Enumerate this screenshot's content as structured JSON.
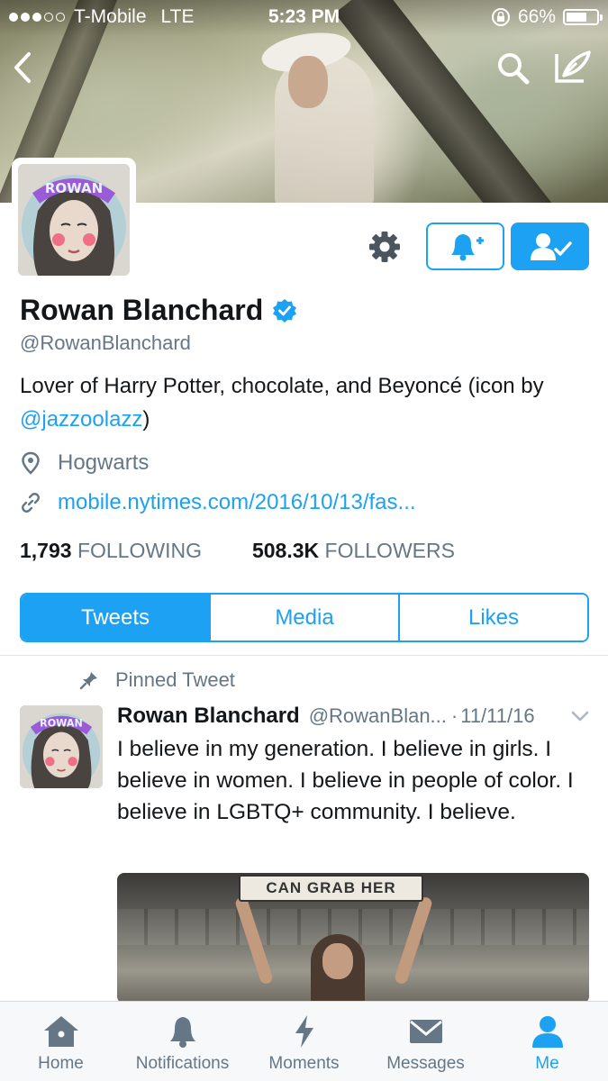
{
  "status_bar": {
    "carrier": "T-Mobile",
    "network": "LTE",
    "time": "5:23 PM",
    "battery": "66%",
    "battery_level": 0.66,
    "signal_bars_filled": 3,
    "signal_bars_total": 5
  },
  "profile": {
    "name": "Rowan Blanchard",
    "handle": "@RowanBlanchard",
    "verified": true,
    "bio_text": "Lover of Harry Potter, chocolate, and Beyoncé (icon by ",
    "bio_mention": "@jazzoolazz",
    "bio_end": ")",
    "location": "Hogwarts",
    "website": "mobile.nytimes.com/2016/10/13/fas...",
    "following_count": "1,793",
    "following_label": "FOLLOWING",
    "followers_count": "508.3K",
    "followers_label": "FOLLOWERS",
    "avatar_lettering": "ROWAN"
  },
  "tabs": [
    {
      "label": "Tweets",
      "active": true
    },
    {
      "label": "Media",
      "active": false
    },
    {
      "label": "Likes",
      "active": false
    }
  ],
  "tweet": {
    "pinned_label": "Pinned Tweet",
    "name": "Rowan Blanchard",
    "handle": "@RowanBlan...",
    "separator": "·",
    "date": "11/11/16",
    "text": "I believe in my generation. I believe in girls. I believe in women. I believe in people of color. I believe in LGBTQ+ community. I believe.",
    "media_sign_text": "CAN GRAB HER"
  },
  "tab_bar": [
    {
      "label": "Home",
      "icon": "home-icon",
      "active": false
    },
    {
      "label": "Notifications",
      "icon": "bell-icon",
      "active": false
    },
    {
      "label": "Moments",
      "icon": "lightning-icon",
      "active": false
    },
    {
      "label": "Messages",
      "icon": "envelope-icon",
      "active": false
    },
    {
      "label": "Me",
      "icon": "person-icon",
      "active": true
    }
  ],
  "colors": {
    "accent": "#1da1f2",
    "text_primary": "#14171a",
    "text_secondary": "#657786"
  }
}
